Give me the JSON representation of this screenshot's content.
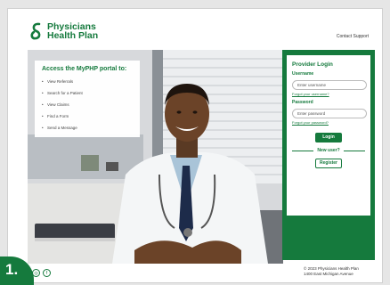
{
  "brand": {
    "name_line1": "Physicians",
    "name_line2": "Health Plan",
    "color": "#157a3d"
  },
  "header": {
    "contact_link": "Contact Support"
  },
  "portal_menu": {
    "title": "Access the MyPHP portal to:",
    "items": [
      {
        "label": "View Referrals"
      },
      {
        "label": "Search for a Patient"
      },
      {
        "label": "View Claims"
      },
      {
        "label": "Find a Form"
      },
      {
        "label": "Send a Message"
      }
    ]
  },
  "login": {
    "title": "Provider Login",
    "username_label": "Username",
    "username_placeholder": "Enter username",
    "forgot_username": "Forgot your username?",
    "password_label": "Password",
    "password_placeholder": "Enter password",
    "forgot_password": "Forgot your password?",
    "login_button": "Login",
    "new_user": "New user?",
    "register_button": "Register"
  },
  "footer": {
    "copyright": "© 2023 Physicians Health Plan",
    "address": "1400 East Michigan Avenue"
  },
  "step_badge": {
    "label": "1."
  }
}
